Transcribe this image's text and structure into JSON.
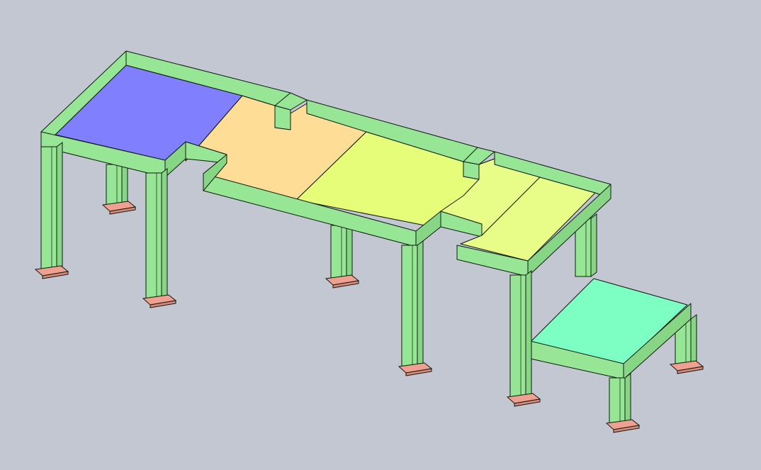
{
  "scene": {
    "background_color": "#c3c7d2",
    "model": "platform-structure",
    "colors": {
      "frame": "#96e696",
      "frame_edge": "#0f1a0f",
      "foot": "#f0a090",
      "deck_blue": "#8080ff",
      "deck_orange": "#fedd96",
      "deck_yellow_green": "#e6fd7a",
      "deck_light_green": "#e8fc88",
      "step_deck": "#7dffc3"
    },
    "parts": [
      "left-platform",
      "middle-platform",
      "right-platform",
      "step-platform",
      "support-legs",
      "base-plates"
    ]
  }
}
